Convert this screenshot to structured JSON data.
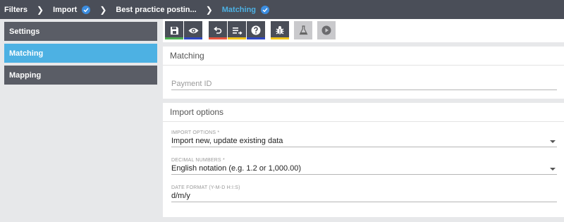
{
  "breadcrumb": [
    {
      "label": "Filters",
      "verified": false,
      "active": false
    },
    {
      "label": "Import",
      "verified": true,
      "active": false
    },
    {
      "label": "Best practice postin...",
      "verified": false,
      "active": false
    },
    {
      "label": "Matching",
      "verified": true,
      "active": true
    }
  ],
  "sidebar": {
    "items": [
      {
        "label": "Settings",
        "active": false
      },
      {
        "label": "Matching",
        "active": true
      },
      {
        "label": "Mapping",
        "active": false
      }
    ]
  },
  "toolbar": {
    "buttons": [
      {
        "name": "save-button",
        "icon": "floppy-icon",
        "bar_color": "#4caf50"
      },
      {
        "name": "preview-button",
        "icon": "eye-icon",
        "bar_color": "#2e47c2"
      },
      {
        "name": "undo-button",
        "icon": "undo-icon",
        "bar_color": "#e8563f"
      },
      {
        "name": "sort-button",
        "icon": "list-arrow-icon",
        "bar_color": "#f0c419"
      },
      {
        "name": "help-button",
        "icon": "question-icon",
        "bar_color": "#2e47c2"
      },
      {
        "name": "debug-button",
        "icon": "bug-icon",
        "bar_color": "#f0c419"
      },
      {
        "name": "test-button",
        "icon": "flask-icon",
        "disabled": true
      },
      {
        "name": "run-button",
        "icon": "play-icon",
        "disabled": true
      }
    ]
  },
  "matching": {
    "title": "Matching",
    "payment_id_placeholder": "Payment ID"
  },
  "import_options": {
    "title": "Import options",
    "import_options_label": "IMPORT OPTIONS *",
    "import_options_value": "Import new, update existing data",
    "decimal_label": "DECIMAL NUMBERS *",
    "decimal_value": "English notation (e.g. 1.2 or 1,000.00)",
    "date_format_label": "DATE FORMAT (Y-M-D H:I:S)",
    "date_format_value": "d/m/y"
  },
  "colors": {
    "topbar": "#4a4e58",
    "accent": "#4db1e3",
    "check": "#3b8de0"
  }
}
